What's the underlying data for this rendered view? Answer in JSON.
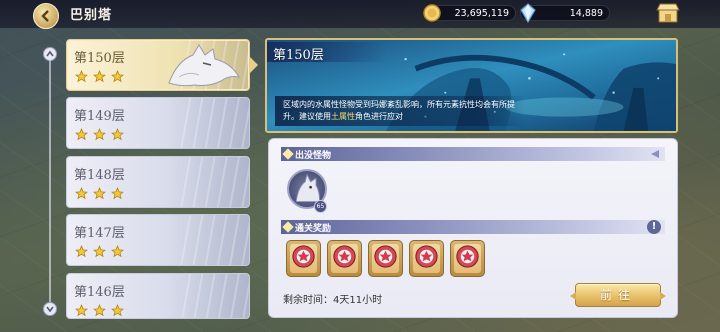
{
  "header": {
    "title": "巴别塔",
    "gold": "23,695,119",
    "gems": "14,889"
  },
  "floors": [
    {
      "name": "第150层",
      "stars": 3,
      "active": true
    },
    {
      "name": "第149层",
      "stars": 3,
      "active": false
    },
    {
      "name": "第148层",
      "stars": 3,
      "active": false
    },
    {
      "name": "第147层",
      "stars": 3,
      "active": false
    },
    {
      "name": "第146层",
      "stars": 3,
      "active": false
    }
  ],
  "banner": {
    "title": "第150层",
    "desc_part1": "区域内的水属性怪物受到玛娜紊乱影响，所有元素抗性均会有所提升。建议使用",
    "desc_highlight": "土属性",
    "desc_part2": "角色进行应对"
  },
  "monsters_section": {
    "label": "出没怪物",
    "monster_level": "65"
  },
  "rewards_section": {
    "label": "通关奖励",
    "info_glyph": "!",
    "count": 5
  },
  "remain_time": "剩余时间：4天11小时",
  "go_button": "前往",
  "colors": {
    "accent_gold": "#e9c46e",
    "section_purple": "#5e6596",
    "highlight": "#f7dd6a"
  }
}
